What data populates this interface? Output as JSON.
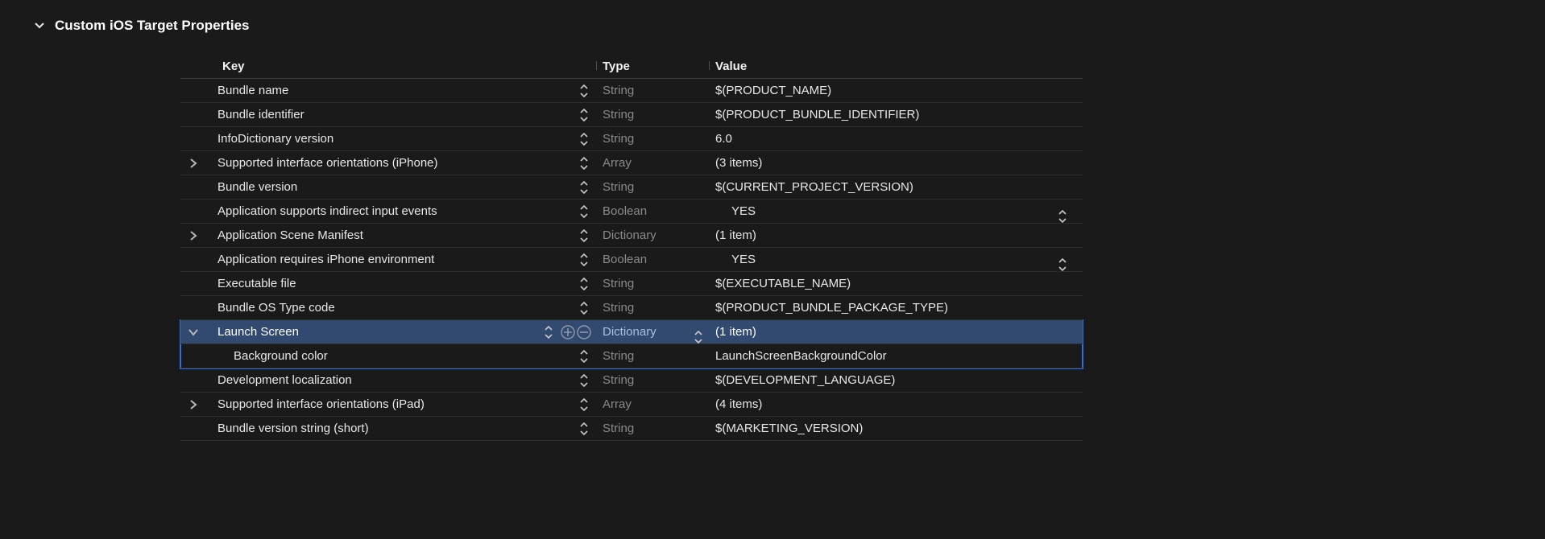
{
  "section": {
    "title": "Custom iOS Target Properties"
  },
  "columns": {
    "key": "Key",
    "type": "Type",
    "value": "Value"
  },
  "rows": [
    {
      "key": "Bundle name",
      "type": "String",
      "value": "$(PRODUCT_NAME)",
      "indent": 0,
      "disclosure": "none",
      "boolStepper": false
    },
    {
      "key": "Bundle identifier",
      "type": "String",
      "value": "$(PRODUCT_BUNDLE_IDENTIFIER)",
      "indent": 0,
      "disclosure": "none",
      "boolStepper": false
    },
    {
      "key": "InfoDictionary version",
      "type": "String",
      "value": "6.0",
      "indent": 0,
      "disclosure": "none",
      "boolStepper": false
    },
    {
      "key": "Supported interface orientations (iPhone)",
      "type": "Array",
      "value": "(3 items)",
      "indent": 0,
      "disclosure": "closed",
      "boolStepper": false
    },
    {
      "key": "Bundle version",
      "type": "String",
      "value": "$(CURRENT_PROJECT_VERSION)",
      "indent": 0,
      "disclosure": "none",
      "boolStepper": false
    },
    {
      "key": "Application supports indirect input events",
      "type": "Boolean",
      "value": "YES",
      "indent": 0,
      "disclosure": "none",
      "boolStepper": true
    },
    {
      "key": "Application Scene Manifest",
      "type": "Dictionary",
      "value": "(1 item)",
      "indent": 0,
      "disclosure": "closed",
      "boolStepper": false
    },
    {
      "key": "Application requires iPhone environment",
      "type": "Boolean",
      "value": "YES",
      "indent": 0,
      "disclosure": "none",
      "boolStepper": true
    },
    {
      "key": "Executable file",
      "type": "String",
      "value": "$(EXECUTABLE_NAME)",
      "indent": 0,
      "disclosure": "none",
      "boolStepper": false
    },
    {
      "key": "Bundle OS Type code",
      "type": "String",
      "value": "$(PRODUCT_BUNDLE_PACKAGE_TYPE)",
      "indent": 0,
      "disclosure": "none",
      "boolStepper": false
    },
    {
      "key": "Launch Screen",
      "type": "Dictionary",
      "value": "(1 item)",
      "indent": 0,
      "disclosure": "open",
      "boolStepper": false,
      "selected": true,
      "showAddRemove": true,
      "showTypeStepper": true
    },
    {
      "key": "Background color",
      "type": "String",
      "value": "LaunchScreenBackgroundColor",
      "indent": 1,
      "disclosure": "none",
      "boolStepper": false,
      "inSelection": true
    },
    {
      "key": "Development localization",
      "type": "String",
      "value": "$(DEVELOPMENT_LANGUAGE)",
      "indent": 0,
      "disclosure": "none",
      "boolStepper": false
    },
    {
      "key": "Supported interface orientations (iPad)",
      "type": "Array",
      "value": "(4 items)",
      "indent": 0,
      "disclosure": "closed",
      "boolStepper": false
    },
    {
      "key": "Bundle version string (short)",
      "type": "String",
      "value": "$(MARKETING_VERSION)",
      "indent": 0,
      "disclosure": "none",
      "boolStepper": false
    }
  ]
}
